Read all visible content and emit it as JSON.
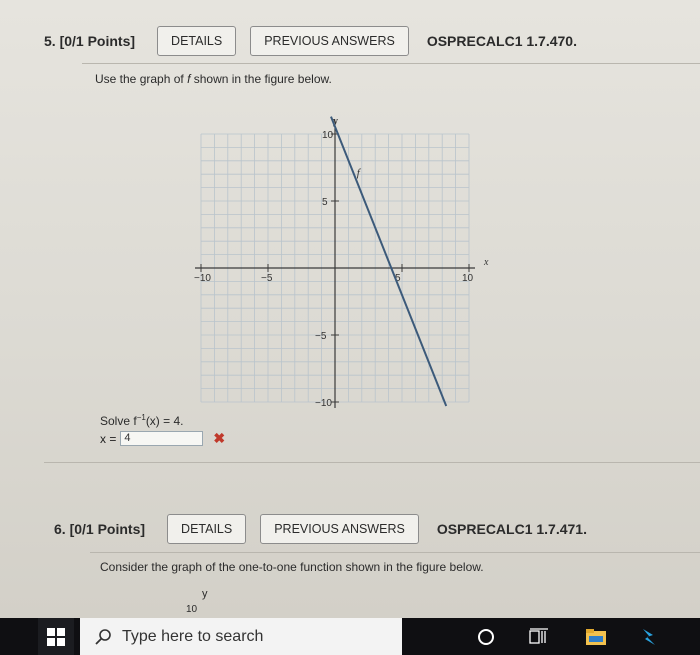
{
  "q5": {
    "number": "5.",
    "points": "[0/1 Points]",
    "details_label": "DETAILS",
    "prev_answers_label": "PREVIOUS ANSWERS",
    "ref": "OSPRECALC1 1.7.470.",
    "prompt_pre": "Use the graph of ",
    "prompt_f": "f",
    "prompt_post": " shown in the figure below.",
    "solve_text": "Solve f",
    "solve_sup": "−1",
    "solve_rest": "(x) = 4.",
    "answer_prefix": "x =",
    "answer_value": "4"
  },
  "q6": {
    "number": "6.",
    "points": "[0/1 Points]",
    "details_label": "DETAILS",
    "prev_answers_label": "PREVIOUS ANSWERS",
    "ref": "OSPRECALC1 1.7.471.",
    "prompt": "Consider the graph of the one-to-one function shown in the figure below.",
    "graph_y_label": "y",
    "graph_y_tick": "10"
  },
  "taskbar": {
    "search_placeholder": "Type here to search"
  },
  "chart_data": {
    "type": "line",
    "xlabel": "x",
    "ylabel": "y",
    "xlim": [
      -10,
      10
    ],
    "ylim": [
      -10,
      10
    ],
    "x_ticks": [
      "-10",
      "-5",
      "5",
      "10"
    ],
    "y_ticks": [
      "10",
      "5",
      "-5",
      "-10"
    ],
    "series": [
      {
        "name": "f",
        "x": [
          -0.3,
          8.3
        ],
        "y": [
          11.3,
          -10.3
        ]
      }
    ],
    "grid": true,
    "line_color": "#3c5a7a"
  }
}
